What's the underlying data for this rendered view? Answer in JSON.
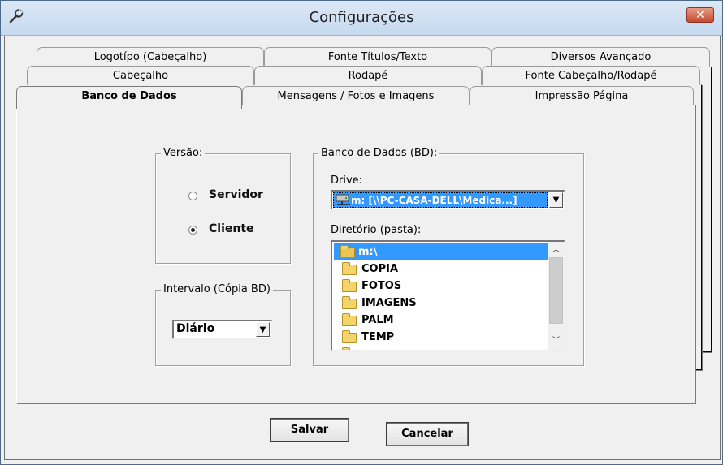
{
  "window": {
    "title": "Configurações",
    "close_glyph": "✕"
  },
  "tabs": {
    "row1": [
      "Logotípo (Cabeçalho)",
      "Fonte Títulos/Texto",
      "Diversos Avançado"
    ],
    "row2": [
      "Cabeçalho",
      "Rodapé",
      "Fonte Cabeçalho/Rodapé"
    ],
    "row3": [
      "Banco de Dados",
      "Mensagens / Fotos e Imagens",
      "Impressão Página"
    ]
  },
  "versao": {
    "legend": "Versão:",
    "options": [
      "Servidor",
      "Cliente"
    ],
    "selected": "Cliente"
  },
  "intervalo": {
    "legend": "Intervalo (Cópia BD)",
    "value": "Diário"
  },
  "banco": {
    "legend": "Banco de Dados (BD):",
    "drive_label": "Drive:",
    "drive_value": "m: [\\\\PC-CASA-DELL\\Medica...]",
    "dir_label": "Diretório (pasta):",
    "dirs": [
      "m:\\",
      "COPIA",
      "FOTOS",
      "IMAGENS",
      "PALM",
      "TEMP"
    ],
    "selected_dir": "m:\\"
  },
  "buttons": {
    "save": "Salvar",
    "cancel": "Cancelar"
  },
  "icons": {
    "app": "wrench-icon",
    "close": "close-icon",
    "drive": "network-drive-icon",
    "folder": "folder-icon"
  }
}
